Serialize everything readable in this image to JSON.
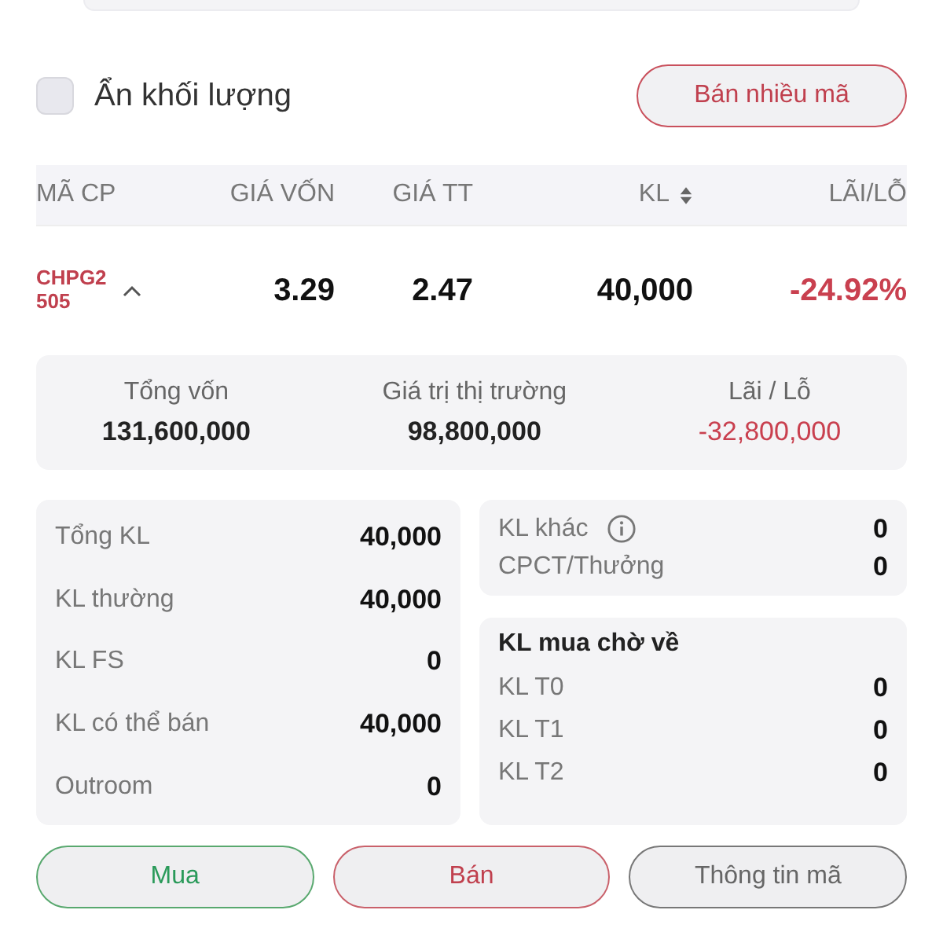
{
  "hide_volume": {
    "label": "Ẩn khối lượng",
    "checked": false
  },
  "sell_many_button": "Bán nhiều mã",
  "table": {
    "columns": [
      {
        "label": "MÃ CP",
        "sortable": false
      },
      {
        "label": "GIÁ VỐN",
        "sortable": false
      },
      {
        "label": "GIÁ TT",
        "sortable": false
      },
      {
        "label": "KL",
        "sortable": true
      },
      {
        "label": "LÃI/LỖ",
        "sortable": false
      }
    ],
    "rows": [
      {
        "symbol": "CHPG2505",
        "expanded": true,
        "cost_price": "3.29",
        "market_price": "2.47",
        "volume": "40,000",
        "profit_loss": "-24.92%",
        "negative": true
      }
    ]
  },
  "summary": [
    {
      "label": "Tổng vốn",
      "value": "131,600,000",
      "negative": false
    },
    {
      "label": "Giá trị thị trường",
      "value": "98,800,000",
      "negative": false
    },
    {
      "label": "Lãi / Lỗ",
      "value": "-32,800,000",
      "negative": true
    }
  ],
  "volume_details": [
    {
      "label": "Tổng KL",
      "value": "40,000"
    },
    {
      "label": "KL thường",
      "value": "40,000"
    },
    {
      "label": "KL FS",
      "value": "0"
    },
    {
      "label": "KL có thể bán",
      "value": "40,000"
    },
    {
      "label": "Outroom",
      "value": "0"
    }
  ],
  "other_volume": [
    {
      "label": "KL khác",
      "value": "0",
      "info": true
    },
    {
      "label": "CPCT/Thưởng",
      "value": "0",
      "info": false
    }
  ],
  "pending_buy": {
    "title": "KL mua chờ về",
    "items": [
      {
        "label": "KL T0",
        "value": "0"
      },
      {
        "label": "KL T1",
        "value": "0"
      },
      {
        "label": "KL T2",
        "value": "0"
      }
    ]
  },
  "actions": [
    {
      "label": "Mua",
      "kind": "buy"
    },
    {
      "label": "Bán",
      "kind": "sell"
    },
    {
      "label": "Thông tin mã",
      "kind": "info"
    }
  ]
}
